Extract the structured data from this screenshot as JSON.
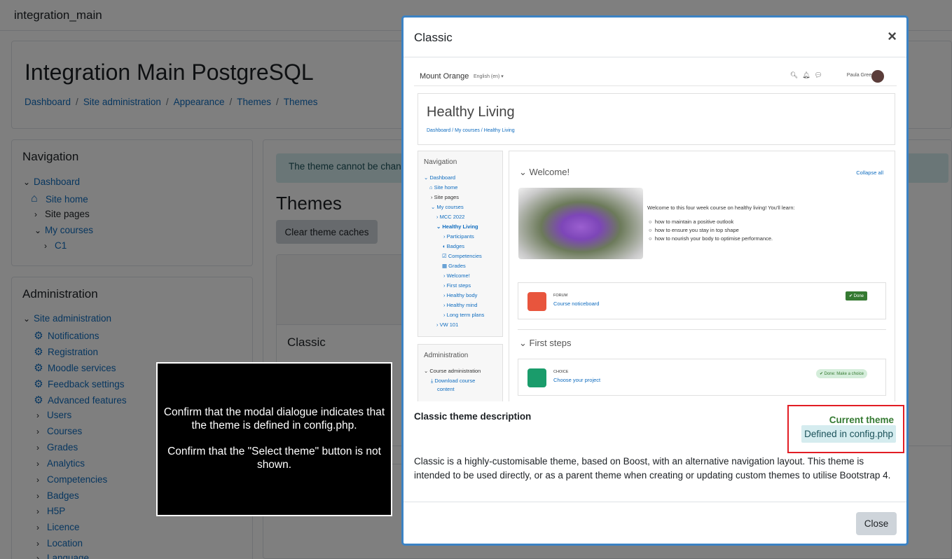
{
  "navbar": {
    "site_name": "integration_main"
  },
  "header": {
    "title": "Integration Main PostgreSQL",
    "breadcrumb": [
      "Dashboard",
      "Site administration",
      "Appearance",
      "Themes",
      "Themes"
    ],
    "separator": "/"
  },
  "navigation": {
    "title": "Navigation",
    "items": [
      "Dashboard",
      "Site home",
      "Site pages",
      "My courses",
      "C1"
    ]
  },
  "administration": {
    "title": "Administration",
    "root": "Site administration",
    "gear_items": [
      "Notifications",
      "Registration",
      "Moodle services",
      "Feedback settings",
      "Advanced features"
    ],
    "collapsed_items": [
      "Users",
      "Courses",
      "Grades",
      "Analytics",
      "Competencies",
      "Badges",
      "H5P",
      "Licence",
      "Location",
      "Language"
    ]
  },
  "main": {
    "alert": "The theme cannot be changed because it is defined in config.php.",
    "heading": "Themes",
    "clear_button": "Clear theme caches",
    "card_name": "Classic"
  },
  "instruction": {
    "line1": "Confirm that the modal dialogue indicates that the theme is defined in config.php.",
    "line2": "Confirm that the \"Select theme\" button is not shown."
  },
  "modal": {
    "title": "Classic",
    "close_glyph": "×",
    "description_title": "Classic theme description",
    "current_theme": "Current theme",
    "defined_badge": "Defined in config.php",
    "description": "Classic is a highly-customisable theme, based on Boost, with an alternative navigation layout. This theme is intended to be used directly, or as a parent theme when creating or updating custom themes to utilise Bootstrap 4.",
    "close_button": "Close"
  },
  "preview": {
    "brand": "Mount Orange",
    "lang": "English (en) ▾",
    "user": "Paula Green",
    "course_title": "Healthy Living",
    "breadcrumb": "Dashboard  /  My courses  /  Healthy Living",
    "nav_title": "Navigation",
    "nav_items": [
      "Dashboard",
      "Site home",
      "Site pages",
      "My courses",
      "MCC 2022",
      "Healthy Living",
      "Participants",
      "Badges",
      "Competencies",
      "Grades",
      "Welcome!",
      "First steps",
      "Healthy body",
      "Healthy mind",
      "Long term plans",
      "VW 101"
    ],
    "admin_title": "Administration",
    "admin_items": [
      "Course administration",
      "Download course",
      "content"
    ],
    "section1": "Welcome!",
    "collapse_all": "Collapse all",
    "intro": "Welcome to this four week course on healthy living! You'll learn:",
    "bullets": [
      "how to maintain a positive outlook",
      "how to ensure you stay in top shape",
      "how to nourish your body to optimise performance."
    ],
    "forum_type": "FORUM",
    "forum_name": "Course noticeboard",
    "done": "✔ Done",
    "section2": "First steps",
    "choice_type": "CHOICE",
    "choice_name": "Choose your project",
    "choice_status": "✔ Done: Make a choice",
    "colors": {
      "forum_icon": "#e8553d",
      "choice_icon": "#1a9c6b"
    }
  }
}
